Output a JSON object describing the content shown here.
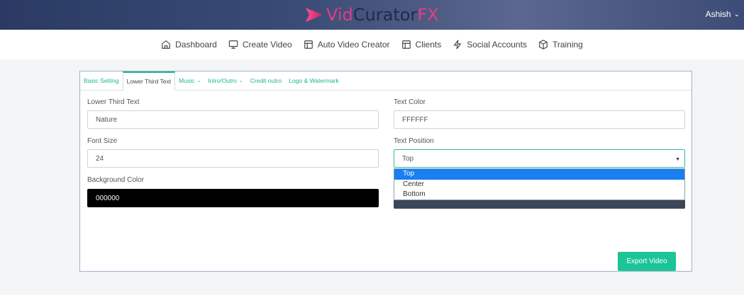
{
  "brand": {
    "vid": "Vid",
    "curator": "Curator",
    "fx": "FX",
    "dot": "."
  },
  "user": {
    "name": "Ashish"
  },
  "nav": [
    {
      "label": "Dashboard",
      "icon": "home-icon"
    },
    {
      "label": "Create Video",
      "icon": "monitor-icon"
    },
    {
      "label": "Auto Video Creator",
      "icon": "layout-icon"
    },
    {
      "label": "Clients",
      "icon": "layout-icon"
    },
    {
      "label": "Social Accounts",
      "icon": "bolt-icon"
    },
    {
      "label": "Training",
      "icon": "box-icon"
    }
  ],
  "tabs": [
    {
      "label": "Basic Setting",
      "dropdown": false
    },
    {
      "label": "Lower Third Text",
      "dropdown": false,
      "active": true
    },
    {
      "label": "Music",
      "dropdown": true
    },
    {
      "label": "Intro/Outro",
      "dropdown": true
    },
    {
      "label": "Credit outro",
      "dropdown": false
    },
    {
      "label": "Logo & Watermark",
      "dropdown": false
    }
  ],
  "form": {
    "lower_third_label": "Lower Third Text",
    "lower_third_value": "Nature",
    "font_size_label": "Font Size",
    "font_size_value": "24",
    "bg_color_label": "Background Color",
    "bg_color_value": "000000",
    "text_color_label": "Text Color",
    "text_color_value": "FFFFFF",
    "text_position_label": "Text Position",
    "text_position_value": "Top",
    "text_position_options": [
      "Top",
      "Center",
      "Bottom"
    ]
  },
  "actions": {
    "export_label": "Export Video"
  },
  "colors": {
    "accent": "#1bc597",
    "tab_text": "#19b98a",
    "header": "#3a4c76",
    "brand_pink": "#e23d84",
    "select_highlight": "#1a7ff0"
  }
}
